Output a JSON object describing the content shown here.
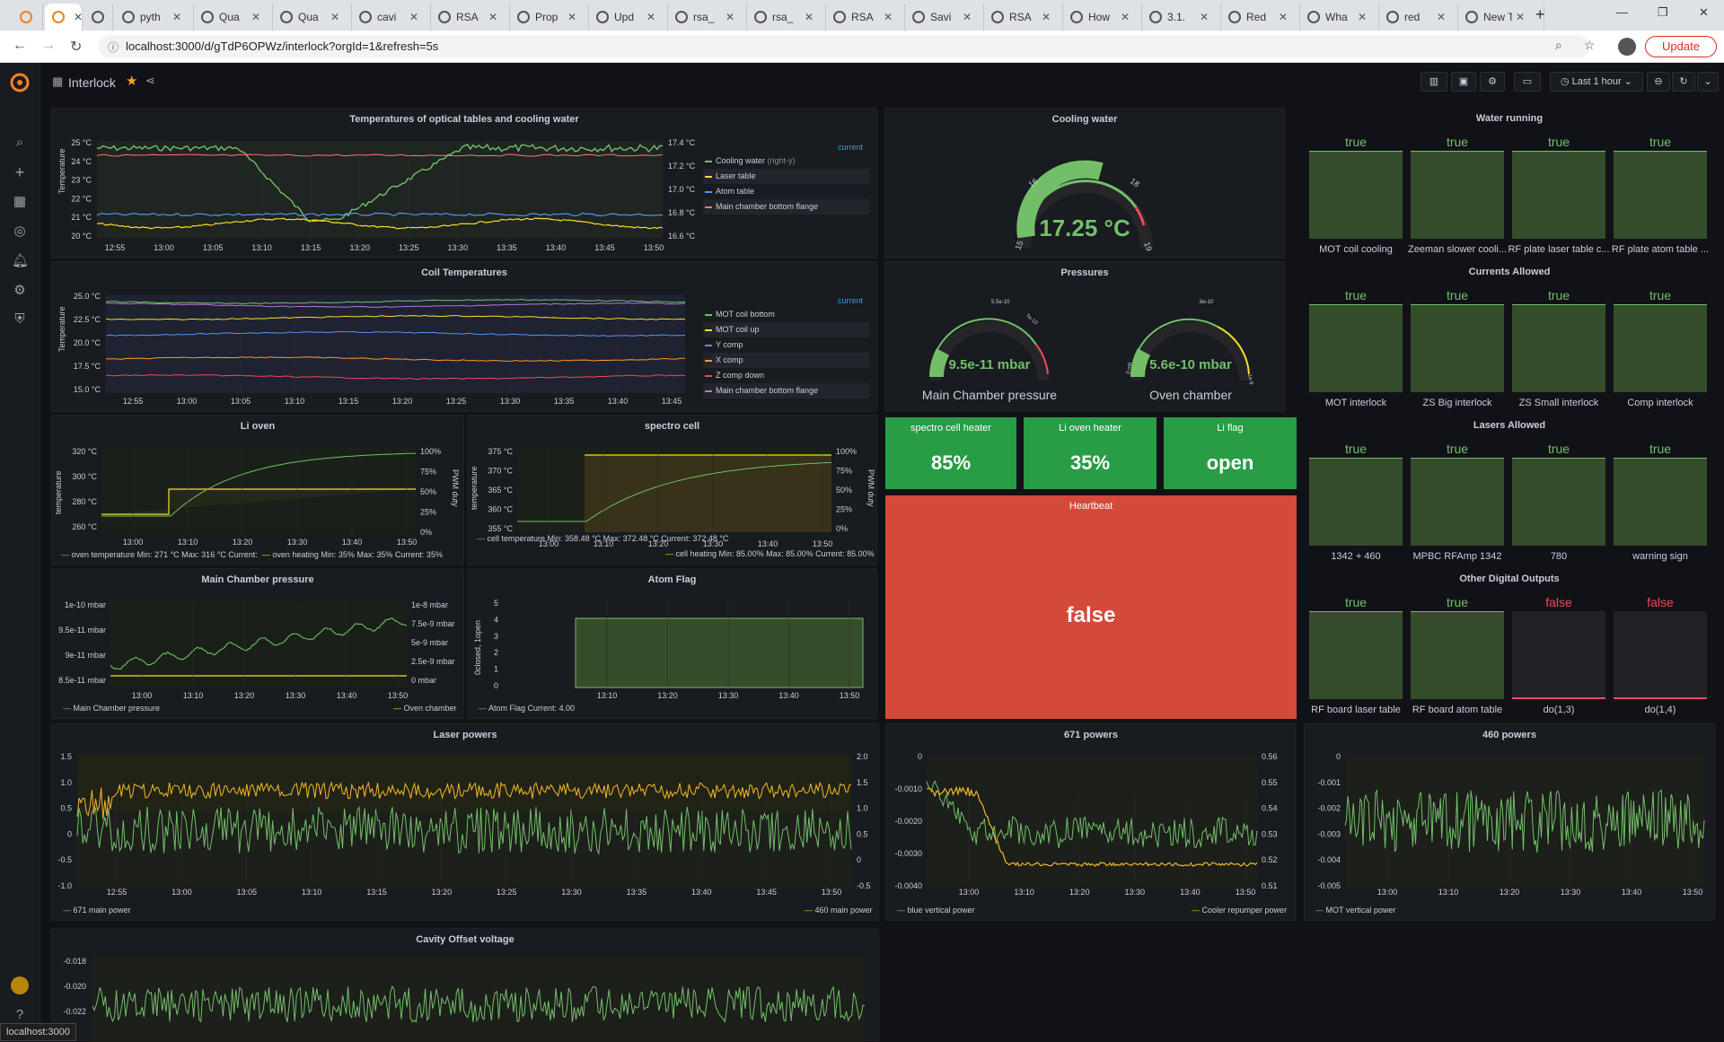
{
  "browser": {
    "tabs": [
      "pyth",
      "Qua",
      "Qua",
      "cavi",
      "RSA",
      "Prop",
      "Upd",
      "rsa_",
      "rsa_",
      "RSA",
      "Savi",
      "RSA",
      "How",
      "3.1.",
      "Red",
      "Wha",
      "red",
      "New Tab"
    ],
    "url": "localhost:3000/d/gTdP6OPWz/interlock?orgId=1&refresh=5s",
    "update_label": "Update",
    "status_url": "localhost:3000"
  },
  "sidebar": {
    "icons": [
      "grafana-logo-icon",
      "search-icon",
      "plus-icon",
      "dashboards-icon",
      "explore-icon",
      "alerting-icon",
      "gear-icon",
      "shield-icon",
      "user-avatar-icon",
      "help-icon"
    ]
  },
  "topbar": {
    "title": "Interlock",
    "time_range": "Last 1 hour"
  },
  "panels": {
    "temps_title": "Temperatures of optical tables and cooling water",
    "temps_current": "current",
    "temps_yaxis": "Temperature",
    "temps_left_ticks": [
      "25 °C",
      "24 °C",
      "23 °C",
      "22 °C",
      "21 °C",
      "20 °C"
    ],
    "temps_right_ticks": [
      "17.4 °C",
      "17.2 °C",
      "17.0 °C",
      "16.8 °C",
      "16.6 °C"
    ],
    "temps_legend": [
      "Cooling water",
      "Laser table",
      "Atom table",
      "Main chamber bottom flange"
    ],
    "temps_legend_suffix": "(right-y)",
    "xticks_hour": [
      "12:55",
      "13:00",
      "13:05",
      "13:10",
      "13:15",
      "13:20",
      "13:25",
      "13:30",
      "13:35",
      "13:40",
      "13:45",
      "13:50"
    ],
    "coil_title": "Coil Temperatures",
    "coil_current": "current",
    "coil_ticks": [
      "25.0 °C",
      "22.5 °C",
      "20.0 °C",
      "17.5 °C",
      "15.0 °C"
    ],
    "coil_legend": [
      "MOT coil bottom",
      "MOT coil up",
      "Y comp",
      "X comp",
      "Z comp down",
      "Main chamber bottom flange"
    ],
    "lioven_title": "Li oven",
    "lioven_ylabel": "temperature",
    "lioven_y2label": "PWM duty",
    "lioven_ticks": [
      "320 °C",
      "300 °C",
      "280 °C",
      "260 °C"
    ],
    "lioven_rticks": [
      "100%",
      "75%",
      "50%",
      "25%",
      "0%"
    ],
    "lioven_xticks": [
      "13:00",
      "13:10",
      "13:20",
      "13:30",
      "13:40",
      "13:50"
    ],
    "lioven_legend1": "oven temperature  Min: 271 °C  Max: 316 °C  Current:",
    "lioven_legend2": "oven heating  Min: 35%  Max: 35%  Current: 35%",
    "spectro_title": "spectro cell",
    "spectro_ylabel": "temperature",
    "spectro_y2label": "PWM duty",
    "spectro_ticks": [
      "375 °C",
      "370 °C",
      "365 °C",
      "360 °C",
      "355 °C"
    ],
    "spectro_rticks": [
      "100%",
      "75%",
      "50%",
      "25%",
      "0%"
    ],
    "spectro_xticks": [
      "13:00",
      "13:10",
      "13:20",
      "13:30",
      "13:40",
      "13:50"
    ],
    "spectro_legend1": "cell temperature  Min: 358.48 °C  Max: 372.48 °C  Current: 372.48 °C",
    "spectro_legend2": "cell heating  Min: 85.00%  Max: 85.00%  Current: 85.00%",
    "mcp_title": "Main Chamber pressure",
    "mcp_ticks": [
      "1e-10 mbar",
      "9.5e-11 mbar",
      "9e-11 mbar",
      "8.5e-11 mbar"
    ],
    "mcp_rticks": [
      "1e-8 mbar",
      "7.5e-9 mbar",
      "5e-9 mbar",
      "2.5e-9 mbar",
      "0 mbar"
    ],
    "mcp_xticks": [
      "13:00",
      "13:10",
      "13:20",
      "13:30",
      "13:40",
      "13:50"
    ],
    "mcp_legend1": "Main Chamber pressure",
    "mcp_legend2": "Oven chamber",
    "atom_title": "Atom Flag",
    "atom_ylabel": "0closed, 1open",
    "atom_ticks": [
      "5",
      "4",
      "3",
      "2",
      "1",
      "0"
    ],
    "atom_xticks": [
      "13:10",
      "13:20",
      "13:30",
      "13:40",
      "13:50"
    ],
    "atom_legend": "Atom Flag  Current: 4.00",
    "cooling_title": "Cooling water",
    "cooling_value": "17.25 °C",
    "cooling_gauge_ticks": [
      "15",
      "16",
      "18",
      "19"
    ],
    "pressures_title": "Pressures",
    "mcpress_value": "9.5e-11 mbar",
    "mcpress_label": "Main Chamber pressure",
    "mcpress_ticks": [
      "5.5e-10",
      "7e-10"
    ],
    "oven_value": "5.6e-10 mbar",
    "oven_label": "Oven chamber",
    "oven_ticks": [
      "8e-10",
      "0 mb",
      "1e-9"
    ],
    "spectro_heater_title": "spectro cell heater",
    "spectro_heater_value": "85%",
    "li_heater_title": "Li oven heater",
    "li_heater_value": "35%",
    "liflag_title": "Li flag",
    "liflag_value": "open",
    "heartbeat_title": "Heartbeat",
    "heartbeat_value": "false",
    "water_title": "Water running",
    "water_items": [
      {
        "v": "true",
        "l": "MOT coil cooling"
      },
      {
        "v": "true",
        "l": "Zeeman slower cooli..."
      },
      {
        "v": "true",
        "l": "RF plate laser table c..."
      },
      {
        "v": "true",
        "l": "RF plate atom table ..."
      }
    ],
    "currents_title": "Currents Allowed",
    "currents_items": [
      {
        "v": "true",
        "l": "MOT interlock"
      },
      {
        "v": "true",
        "l": "ZS Big interlock"
      },
      {
        "v": "true",
        "l": "ZS Small interlock"
      },
      {
        "v": "true",
        "l": "Comp interlock"
      }
    ],
    "lasers_title": "Lasers Allowed",
    "lasers_items": [
      {
        "v": "true",
        "l": "1342 + 460"
      },
      {
        "v": "true",
        "l": "MPBC RFAmp 1342"
      },
      {
        "v": "true",
        "l": "780"
      },
      {
        "v": "true",
        "l": "warning sign"
      }
    ],
    "other_title": "Other Digital Outputs",
    "other_items": [
      {
        "v": "true",
        "l": "RF board laser table"
      },
      {
        "v": "true",
        "l": "RF board atom table"
      },
      {
        "v": "false",
        "l": "do(1,3)"
      },
      {
        "v": "false",
        "l": "do(1,4)"
      }
    ],
    "laser_title": "Laser powers",
    "laser_ticks": [
      "1.5",
      "1.0",
      "0.5",
      "0",
      "-0.5",
      "-1.0"
    ],
    "laser_rticks": [
      "2.0",
      "1.5",
      "1.0",
      "0.5",
      "0",
      "-0.5"
    ],
    "laser_legend1": "671 main power",
    "laser_legend2": "460 main power",
    "p671_title": "671 powers",
    "p671_ticks": [
      "0",
      "-0.0010",
      "-0.0020",
      "-0.0030",
      "-0.0040"
    ],
    "p671_rticks": [
      "0.56",
      "0.55",
      "0.54",
      "0.53",
      "0.52",
      "0.51"
    ],
    "p671_xticks": [
      "13:00",
      "13:10",
      "13:20",
      "13:30",
      "13:40",
      "13:50"
    ],
    "p671_legend1": "blue vertical power",
    "p671_legend2": "Cooler repumper power",
    "p460_title": "460 powers",
    "p460_ticks": [
      "0",
      "-0.001",
      "-0.002",
      "-0.003",
      "-0.004",
      "-0.005"
    ],
    "p460_xticks": [
      "13:00",
      "13:10",
      "13:20",
      "13:30",
      "13:40",
      "13:50"
    ],
    "p460_legend": "MOT vertical power",
    "cavity_title": "Cavity Offset voltage",
    "cavity_ticks": [
      "-0.018",
      "-0.020",
      "-0.022"
    ]
  }
}
